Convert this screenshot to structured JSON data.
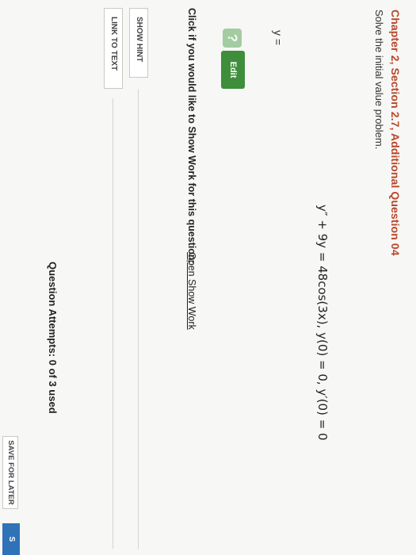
{
  "header": {
    "title": "Chapter 2, Section 2.7, Additional Question 04",
    "instruction": "Solve the initial value problem."
  },
  "question": {
    "equation": "y″ + 9y = 48cos(3x), y(0) = 0, y′(0) = 0",
    "answer_label": "y ="
  },
  "answer_tools": {
    "help_glyph": "?",
    "edit_label": "Edit"
  },
  "show_work": {
    "prompt": "Click if you would like to Show Work for this question:",
    "link_label": "Open Show Work"
  },
  "aids": {
    "hint_label": "SHOW HINT",
    "link_text_label": "LINK TO TEXT"
  },
  "footer": {
    "attempts": "Question Attempts: 0 of 3 used",
    "save_label": "SAVE FOR LATER",
    "submit_label": "S"
  },
  "colors": {
    "title": "#b9472a",
    "edit_green": "#3e8e3b",
    "submit_blue": "#2f72b7"
  }
}
